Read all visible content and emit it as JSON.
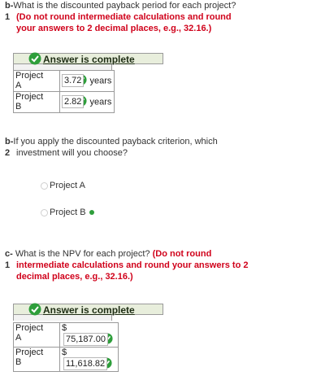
{
  "b1": {
    "label": "b-",
    "num": "1",
    "line1": "What is the discounted payback period for each project?",
    "line2": "(Do not round intermediate calculations and round",
    "line3": "your answers to 2 decimal places, e.g., 32.16.)"
  },
  "answer_banner": "Answer is complete",
  "b1_rows": [
    {
      "project": "Project",
      "letter": "A",
      "value": "3.72",
      "unit": "years"
    },
    {
      "project": "Project",
      "letter": "B",
      "value": "2.82",
      "unit": "years"
    }
  ],
  "b2": {
    "label": "b-",
    "num": "2",
    "line1": "If you apply the discounted payback criterion, which",
    "line2": "investment will you choose?"
  },
  "b2_options": [
    "Project A",
    "Project B"
  ],
  "b2_selected": "Project B",
  "c1": {
    "label": "c-",
    "num": "1",
    "line1a": "What is the NPV for each project?",
    "line1b": "(Do not round",
    "line2": "intermediate calculations and round your answers to 2",
    "line3": "decimal places, e.g., 32.16.)"
  },
  "c1_rows": [
    {
      "project": "Project",
      "letter": "A",
      "currency": "$",
      "value": "75,187.00"
    },
    {
      "project": "Project",
      "letter": "B",
      "currency": "$",
      "value": "11,618.82"
    }
  ],
  "colors": {
    "required": "#d0021b",
    "correct": "#2e9e3b"
  }
}
